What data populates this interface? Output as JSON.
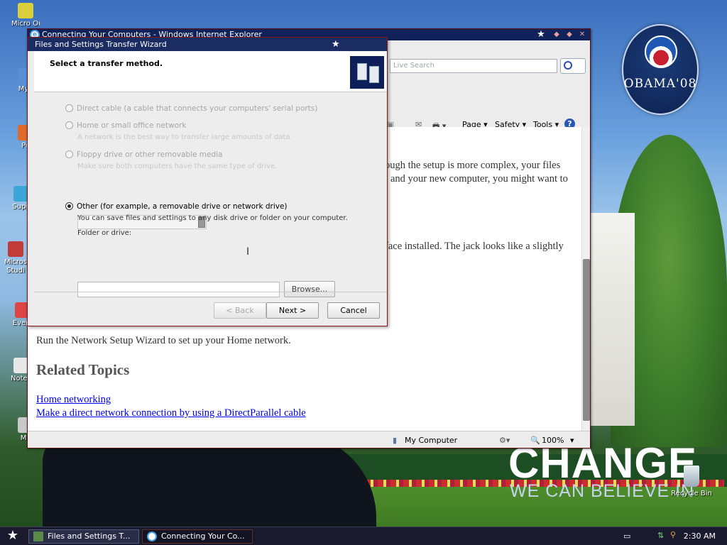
{
  "desktop": {
    "icons": [
      {
        "label": "Micro Outl",
        "color": "#d8cf3a"
      },
      {
        "label": "MyP",
        "color": "#5a8fd6"
      },
      {
        "label": "Pe",
        "color": "#e06a2a"
      },
      {
        "label": "Supe",
        "color": "#3aa7d6"
      },
      {
        "label": "Micros Studi",
        "color": "#c23a3a"
      },
      {
        "label": "Every",
        "color": "#d44"
      },
      {
        "label": "Notep",
        "color": "#e8e8e8"
      },
      {
        "label": "My",
        "color": "#c9c9c9"
      }
    ],
    "recycle_label": "Recycle Bin",
    "obama_badge_text": "OBAMA'08",
    "change_text": "CHANGE",
    "change_sub": "WE CAN BELIEVE IN"
  },
  "ie": {
    "title": "Connecting Your Computers - Windows Internet Explorer",
    "search_placeholder": "Live Search",
    "cmd": {
      "page": "Page ▾",
      "safety": "Safety ▾",
      "tools": "Tools ▾"
    },
    "content": {
      "line1": "ough the setup is more complex, your files",
      "line2": "and your new computer, you might want to",
      "line3": "face installed. The jack looks like a slightly",
      "network_setup": "Run the Network Setup Wizard to set up your Home network.",
      "related_title": "Related Topics",
      "links": [
        "Home networking",
        "Make a direct network connection by using a DirectParallel cable"
      ]
    },
    "status": {
      "zone": "My Computer",
      "zoom": "100%"
    }
  },
  "wizard": {
    "title": "Files and Settings Transfer Wizard",
    "heading": "Select a transfer method.",
    "options": {
      "direct_cable": "Direct cable (a cable that connects your computers' serial ports)",
      "home_network": "Home or small office network",
      "home_network_desc": "A network is the best way to transfer large amounts of data.",
      "floppy": "Floppy drive or other removable media",
      "floppy_desc": "Make sure both computers have the same type of drive.",
      "other": "Other (for example, a removable drive or network drive)",
      "other_desc": "You can save files and settings to any disk drive or folder on your computer.",
      "folder_label": "Folder or drive:"
    },
    "folder_value": "",
    "buttons": {
      "browse": "Browse...",
      "back": "< Back",
      "next": "Next >",
      "cancel": "Cancel"
    }
  },
  "taskbar": {
    "tasks": [
      "Files and Settings T...",
      "Connecting Your Co..."
    ],
    "clock": "2:30 AM"
  }
}
